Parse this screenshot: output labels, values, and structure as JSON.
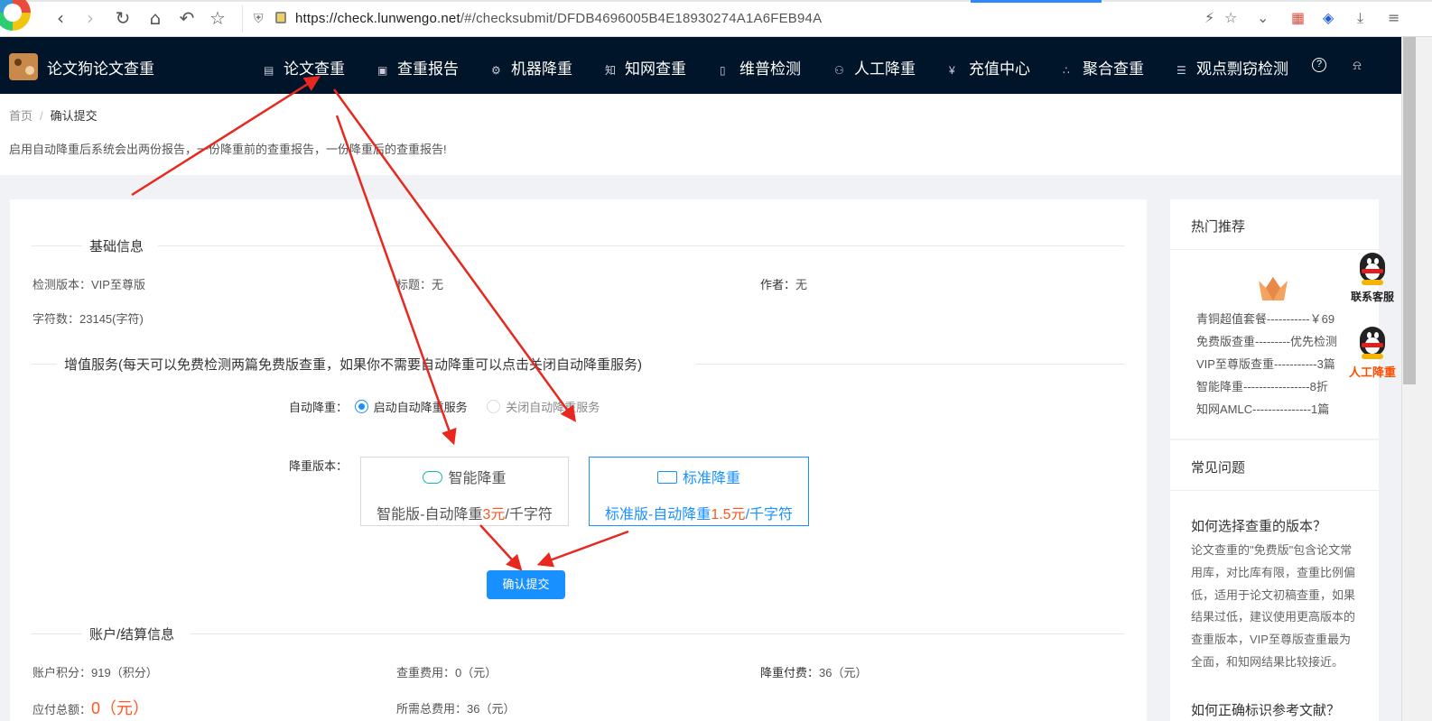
{
  "browser": {
    "url_host": "https://check.lunwengo.net",
    "url_path": "/#/checksubmit/DFDB4696005B4E18930274A1A6FEB94A",
    "icons": [
      "back-icon",
      "forward-icon",
      "reload-icon",
      "home-icon",
      "undo-icon",
      "star-icon",
      "shield-icon",
      "lock-icon",
      "bolt-icon",
      "bookmark-star-icon",
      "chevron-down-icon",
      "apps-icon",
      "extension-icon",
      "download-icon",
      "menu-icon"
    ]
  },
  "site": {
    "brand": "论文狗论文查重",
    "menu": [
      {
        "label": "论文查重",
        "icon": "doc-icon"
      },
      {
        "label": "查重报告",
        "icon": "report-icon"
      },
      {
        "label": "机器降重",
        "icon": "robot-icon"
      },
      {
        "label": "知网查重",
        "icon": "zhi-icon"
      },
      {
        "label": "维普检测",
        "icon": "file-icon"
      },
      {
        "label": "人工降重",
        "icon": "person-icon"
      },
      {
        "label": "充值中心",
        "icon": "yen-icon"
      },
      {
        "label": "聚合查重",
        "icon": "cluster-icon"
      },
      {
        "label": "观点剽窃检测",
        "icon": "list-icon"
      }
    ],
    "help_glyph": "?"
  },
  "breadcrumb": {
    "home": "首页",
    "sep": "/",
    "current": "确认提交"
  },
  "notice": "启用自动降重后系统会出两份报告，一份降重前的查重报告，一份降重后的查重报告!",
  "basic": {
    "title": "基础信息",
    "version_k": "检测版本：",
    "version_v": "VIP至尊版",
    "title_k": "标题：",
    "title_v": "无",
    "author_k": "作者：",
    "author_v": "无",
    "chars_k": "字符数：",
    "chars_v": "23145(字符)"
  },
  "addon": {
    "title": "增值服务(每天可以免费检测两篇免费版查重，如果你不需要自动降重可以点击关闭自动降重服务)",
    "auto_label": "自动降重：",
    "opt_on": "启动自动降重服务",
    "opt_off": "关闭自动降重服务",
    "version_label": "降重版本：",
    "smart": {
      "name": "智能降重",
      "desc_pre": "智能版-自动降重",
      "price": "3元",
      "desc_post": "/千字符"
    },
    "standard": {
      "name": "标准降重",
      "desc_pre": "标准版-自动降重",
      "price": "1.5元",
      "desc_post": "/千字符"
    },
    "submit": "确认提交"
  },
  "account": {
    "title": "账户/结算信息",
    "points_k": "账户积分：",
    "points_v": "919（积分）",
    "check_fee_k": "查重费用：",
    "check_fee_v": "0（元）",
    "reduce_fee_k": "降重付费：",
    "reduce_fee_v": "36（元）",
    "due_k": "应付总额：",
    "due_v": "0（元）",
    "total_k": "所需总费用：",
    "total_v": "36（元）"
  },
  "sidebar": {
    "hot_title": "热门推荐",
    "items": [
      "青铜超值套餐-----------￥69",
      "免费版查重---------优先检测",
      "VIP至尊版查重-----------3篇",
      "智能降重-----------------8折",
      "知网AMLC---------------1篇"
    ],
    "faq_title": "常见问题",
    "faq_q1": "如何选择查重的版本？",
    "faq_a1": "论文查重的\"免费版\"包含论文常用库，对比库有限，查重比例偏低，适用于论文初稿查重，如果结果过低，建议使用更高版本的查重版本，VIP至尊版查重最为全面，和知网结果比较接近。",
    "faq_q2": "如何正确标识参考文献？"
  },
  "float": {
    "contact": "联系客服",
    "manual": "人工降重"
  },
  "colors": {
    "nav_bg": "#001529",
    "primary": "#1890ff",
    "price": "#ff5722",
    "annotation": "#e8281e"
  }
}
